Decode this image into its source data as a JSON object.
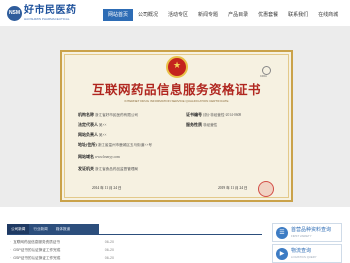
{
  "logo": {
    "badge": "NSM",
    "name": "好市民医药",
    "sub": "HAOSHIMIN PHARMACEUTICAL"
  },
  "nav": [
    {
      "label": "网站首页",
      "active": true
    },
    {
      "label": "公司概况"
    },
    {
      "label": "活动专区"
    },
    {
      "label": "新闻专题"
    },
    {
      "label": "产品目录"
    },
    {
      "label": "优惠套餐"
    },
    {
      "label": "联系我们"
    },
    {
      "label": "在线商城"
    }
  ],
  "certificate": {
    "title": "互联网药品信息服务资格证书",
    "subtitle": "INTERNET DRUG INFORMATION SERVICE QUALIFICATION CERTIFICATE",
    "barcode_label": "CFDA",
    "fields": {
      "org_name_label": "机构名称",
      "org_name_value": "浙江省好市民医药有限公司",
      "cert_no_label": "证书编号",
      "cert_no_value": "(浙)-非经营性-2014-0608",
      "legal_rep_label": "法定代表人",
      "legal_rep_value": "吴××",
      "service_nature_label": "服务性质",
      "service_nature_value": "非经营性",
      "site_owner_label": "网站负责人",
      "site_owner_value": "吴××",
      "address_label": "地址(住所)",
      "address_value": "浙江省温州市鹿城区五马街道××号",
      "domain_label": "网站域名",
      "domain_value": "www.hsmyy.com",
      "issuer_label": "发证机关",
      "issuer_value": "浙江省食品药品监督管理局"
    },
    "issue_date": "2014 年 11 月 24 日",
    "expiry_date": "2019 年 11 月 24 日"
  },
  "slider": {
    "count": 3,
    "active": 1
  },
  "tabs": [
    {
      "label": "公司新闻",
      "active": true
    },
    {
      "label": "行业新闻"
    },
    {
      "label": "媒体报道"
    }
  ],
  "news": [
    {
      "title": "互联网药品信息服务资质证书",
      "date": "06-20"
    },
    {
      "title": "GSP证书的认证换证工作完成",
      "date": "06-20"
    },
    {
      "title": "GSP证书的认证换证工作完成",
      "date": "06-20"
    }
  ],
  "side_cards": [
    {
      "title": "首营品种资料查询",
      "sub": "FIRST VARIETY",
      "icon": "document-search-icon"
    },
    {
      "title": "物流查询",
      "sub": "LOGISTICS QUERY",
      "icon": "truck-icon"
    }
  ],
  "colors": {
    "brand_blue": "#2d6cb5",
    "tab_dark": "#2c4e7c",
    "cert_red": "#b0261f",
    "cert_gold": "#caa24a"
  }
}
